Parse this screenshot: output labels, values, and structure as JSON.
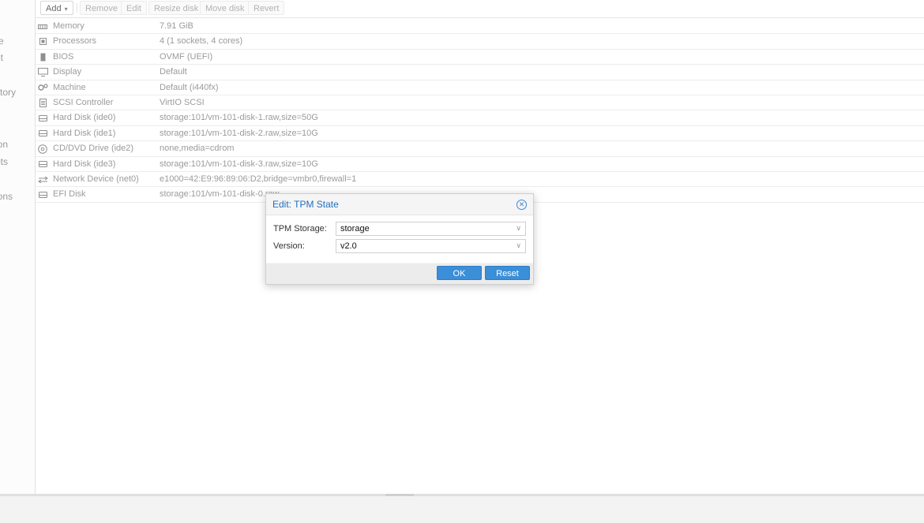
{
  "leftnav": {
    "items": [
      {
        "label": "y"
      },
      {
        "label": "re"
      },
      {
        "label": "ut"
      },
      {
        "label": "story"
      },
      {
        "label": "ion"
      },
      {
        "label": "ots"
      },
      {
        "label": "ions"
      }
    ]
  },
  "toolbar": {
    "add_label": "Add",
    "remove_label": "Remove",
    "edit_label": "Edit",
    "resize_label": "Resize disk",
    "move_label": "Move disk",
    "revert_label": "Revert"
  },
  "hardware": {
    "rows": [
      {
        "icon": "memory-icon",
        "label": "Memory",
        "value": "7.91 GiB"
      },
      {
        "icon": "processor-icon",
        "label": "Processors",
        "value": "4 (1 sockets, 4 cores)"
      },
      {
        "icon": "bios-icon",
        "label": "BIOS",
        "value": "OVMF (UEFI)"
      },
      {
        "icon": "display-icon",
        "label": "Display",
        "value": "Default"
      },
      {
        "icon": "machine-icon",
        "label": "Machine",
        "value": "Default (i440fx)"
      },
      {
        "icon": "controller-icon",
        "label": "SCSI Controller",
        "value": "VirtIO SCSI"
      },
      {
        "icon": "harddisk-icon",
        "label": "Hard Disk (ide0)",
        "value": "storage:101/vm-101-disk-1.raw,size=50G"
      },
      {
        "icon": "harddisk-icon",
        "label": "Hard Disk (ide1)",
        "value": "storage:101/vm-101-disk-2.raw,size=10G"
      },
      {
        "icon": "cdrom-icon",
        "label": "CD/DVD Drive (ide2)",
        "value": "none,media=cdrom"
      },
      {
        "icon": "harddisk-icon",
        "label": "Hard Disk (ide3)",
        "value": "storage:101/vm-101-disk-3.raw,size=10G"
      },
      {
        "icon": "network-icon",
        "label": "Network Device (net0)",
        "value": "e1000=42:E9:96:89:06:D2,bridge=vmbr0,firewall=1"
      },
      {
        "icon": "harddisk-icon",
        "label": "EFI Disk",
        "value": "storage:101/vm-101-disk-0.raw"
      }
    ]
  },
  "dialog": {
    "title": "Edit: TPM State",
    "storage_label": "TPM Storage:",
    "storage_value": "storage",
    "version_label": "Version:",
    "version_value": "v2.0",
    "ok_label": "OK",
    "reset_label": "Reset",
    "accent_color": "#3b8ed8"
  }
}
